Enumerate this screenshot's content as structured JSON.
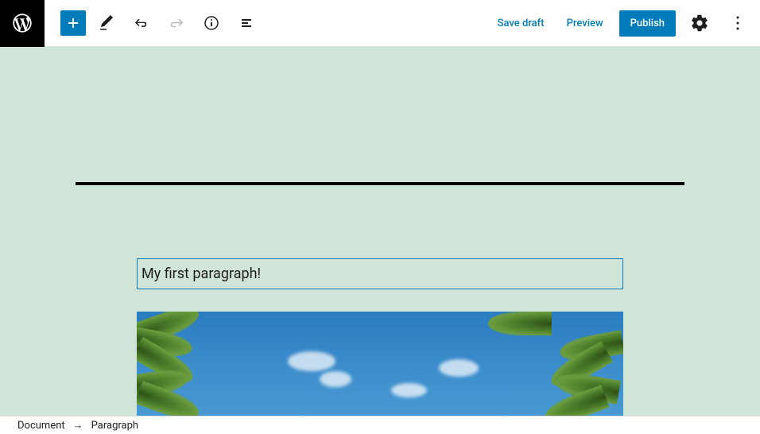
{
  "toolbar": {
    "save_draft_label": "Save draft",
    "preview_label": "Preview",
    "publish_label": "Publish"
  },
  "content": {
    "paragraph_text": "My first paragraph!"
  },
  "breadcrumb": {
    "root": "Document",
    "current": "Paragraph"
  },
  "colors": {
    "accent": "#007cba",
    "canvas_bg": "#d0e5d7"
  }
}
